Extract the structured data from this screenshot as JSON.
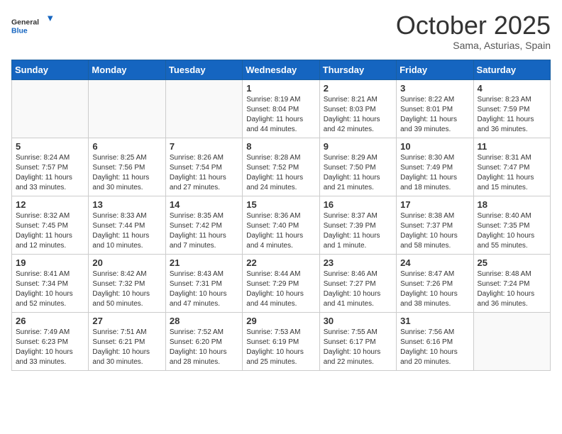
{
  "header": {
    "logo_general": "General",
    "logo_blue": "Blue",
    "month_title": "October 2025",
    "subtitle": "Sama, Asturias, Spain"
  },
  "weekdays": [
    "Sunday",
    "Monday",
    "Tuesday",
    "Wednesday",
    "Thursday",
    "Friday",
    "Saturday"
  ],
  "weeks": [
    [
      {
        "day": "",
        "info": ""
      },
      {
        "day": "",
        "info": ""
      },
      {
        "day": "",
        "info": ""
      },
      {
        "day": "1",
        "info": "Sunrise: 8:19 AM\nSunset: 8:04 PM\nDaylight: 11 hours\nand 44 minutes."
      },
      {
        "day": "2",
        "info": "Sunrise: 8:21 AM\nSunset: 8:03 PM\nDaylight: 11 hours\nand 42 minutes."
      },
      {
        "day": "3",
        "info": "Sunrise: 8:22 AM\nSunset: 8:01 PM\nDaylight: 11 hours\nand 39 minutes."
      },
      {
        "day": "4",
        "info": "Sunrise: 8:23 AM\nSunset: 7:59 PM\nDaylight: 11 hours\nand 36 minutes."
      }
    ],
    [
      {
        "day": "5",
        "info": "Sunrise: 8:24 AM\nSunset: 7:57 PM\nDaylight: 11 hours\nand 33 minutes."
      },
      {
        "day": "6",
        "info": "Sunrise: 8:25 AM\nSunset: 7:56 PM\nDaylight: 11 hours\nand 30 minutes."
      },
      {
        "day": "7",
        "info": "Sunrise: 8:26 AM\nSunset: 7:54 PM\nDaylight: 11 hours\nand 27 minutes."
      },
      {
        "day": "8",
        "info": "Sunrise: 8:28 AM\nSunset: 7:52 PM\nDaylight: 11 hours\nand 24 minutes."
      },
      {
        "day": "9",
        "info": "Sunrise: 8:29 AM\nSunset: 7:50 PM\nDaylight: 11 hours\nand 21 minutes."
      },
      {
        "day": "10",
        "info": "Sunrise: 8:30 AM\nSunset: 7:49 PM\nDaylight: 11 hours\nand 18 minutes."
      },
      {
        "day": "11",
        "info": "Sunrise: 8:31 AM\nSunset: 7:47 PM\nDaylight: 11 hours\nand 15 minutes."
      }
    ],
    [
      {
        "day": "12",
        "info": "Sunrise: 8:32 AM\nSunset: 7:45 PM\nDaylight: 11 hours\nand 12 minutes."
      },
      {
        "day": "13",
        "info": "Sunrise: 8:33 AM\nSunset: 7:44 PM\nDaylight: 11 hours\nand 10 minutes."
      },
      {
        "day": "14",
        "info": "Sunrise: 8:35 AM\nSunset: 7:42 PM\nDaylight: 11 hours\nand 7 minutes."
      },
      {
        "day": "15",
        "info": "Sunrise: 8:36 AM\nSunset: 7:40 PM\nDaylight: 11 hours\nand 4 minutes."
      },
      {
        "day": "16",
        "info": "Sunrise: 8:37 AM\nSunset: 7:39 PM\nDaylight: 11 hours\nand 1 minute."
      },
      {
        "day": "17",
        "info": "Sunrise: 8:38 AM\nSunset: 7:37 PM\nDaylight: 10 hours\nand 58 minutes."
      },
      {
        "day": "18",
        "info": "Sunrise: 8:40 AM\nSunset: 7:35 PM\nDaylight: 10 hours\nand 55 minutes."
      }
    ],
    [
      {
        "day": "19",
        "info": "Sunrise: 8:41 AM\nSunset: 7:34 PM\nDaylight: 10 hours\nand 52 minutes."
      },
      {
        "day": "20",
        "info": "Sunrise: 8:42 AM\nSunset: 7:32 PM\nDaylight: 10 hours\nand 50 minutes."
      },
      {
        "day": "21",
        "info": "Sunrise: 8:43 AM\nSunset: 7:31 PM\nDaylight: 10 hours\nand 47 minutes."
      },
      {
        "day": "22",
        "info": "Sunrise: 8:44 AM\nSunset: 7:29 PM\nDaylight: 10 hours\nand 44 minutes."
      },
      {
        "day": "23",
        "info": "Sunrise: 8:46 AM\nSunset: 7:27 PM\nDaylight: 10 hours\nand 41 minutes."
      },
      {
        "day": "24",
        "info": "Sunrise: 8:47 AM\nSunset: 7:26 PM\nDaylight: 10 hours\nand 38 minutes."
      },
      {
        "day": "25",
        "info": "Sunrise: 8:48 AM\nSunset: 7:24 PM\nDaylight: 10 hours\nand 36 minutes."
      }
    ],
    [
      {
        "day": "26",
        "info": "Sunrise: 7:49 AM\nSunset: 6:23 PM\nDaylight: 10 hours\nand 33 minutes."
      },
      {
        "day": "27",
        "info": "Sunrise: 7:51 AM\nSunset: 6:21 PM\nDaylight: 10 hours\nand 30 minutes."
      },
      {
        "day": "28",
        "info": "Sunrise: 7:52 AM\nSunset: 6:20 PM\nDaylight: 10 hours\nand 28 minutes."
      },
      {
        "day": "29",
        "info": "Sunrise: 7:53 AM\nSunset: 6:19 PM\nDaylight: 10 hours\nand 25 minutes."
      },
      {
        "day": "30",
        "info": "Sunrise: 7:55 AM\nSunset: 6:17 PM\nDaylight: 10 hours\nand 22 minutes."
      },
      {
        "day": "31",
        "info": "Sunrise: 7:56 AM\nSunset: 6:16 PM\nDaylight: 10 hours\nand 20 minutes."
      },
      {
        "day": "",
        "info": ""
      }
    ]
  ]
}
